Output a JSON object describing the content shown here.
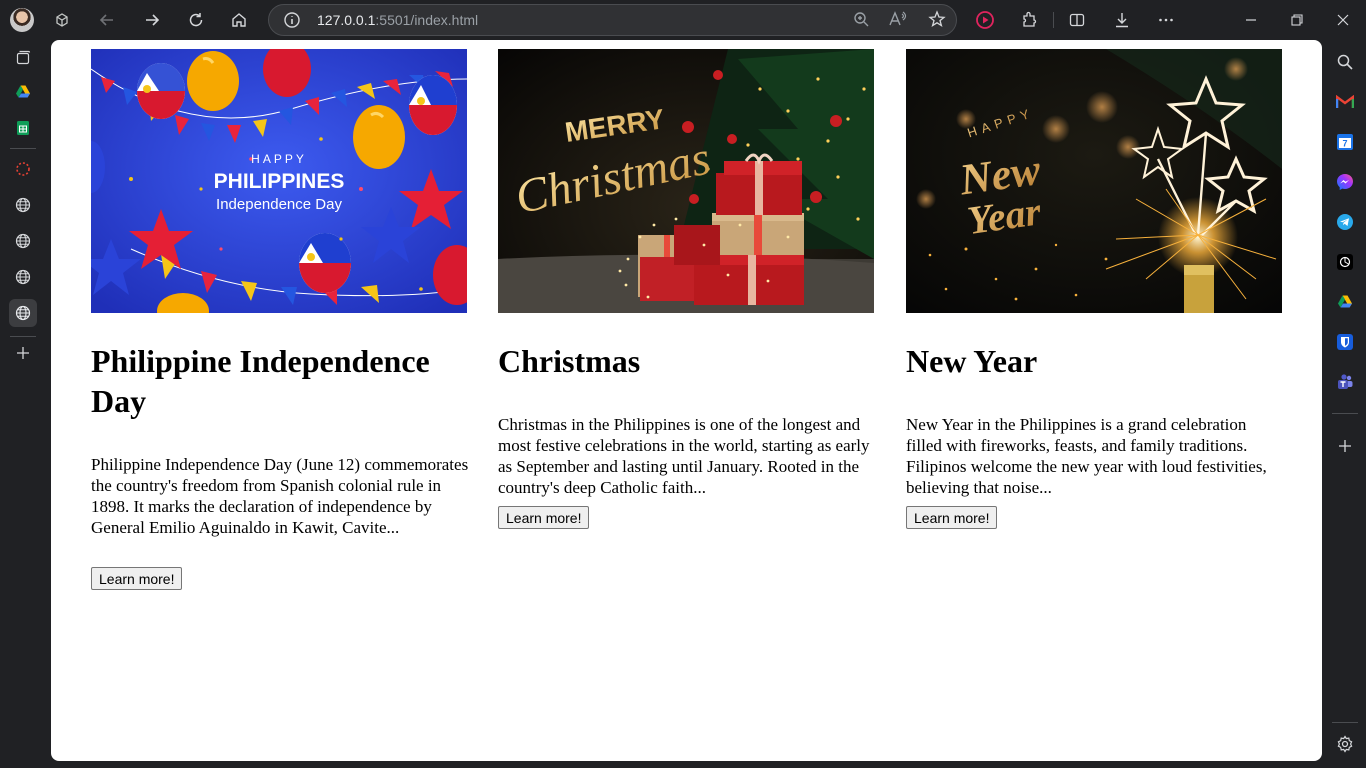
{
  "browser": {
    "url_host": "127.0.0.1",
    "url_rest": ":5501/index.html"
  },
  "cards": [
    {
      "title": "Philippine Independence Day",
      "text": "Philippine Independence Day (June 12) commemorates the country's freedom from Spanish colonial rule in 1898. It marks the declaration of independence by General Emilio Aguinaldo in Kawit, Cavite...",
      "button": "Learn more!",
      "image": {
        "line1": "HAPPY",
        "line2": "PHILIPPINES",
        "line3": "Independence Day"
      }
    },
    {
      "title": "Christmas",
      "text": "Christmas in the Philippines is one of the longest and most festive celebrations in the world, starting as early as September and lasting until January. Rooted in the country's deep Catholic faith...",
      "button": "Learn more!",
      "image": {
        "line1": "MERRY",
        "line2": "Christmas"
      }
    },
    {
      "title": "New Year",
      "text": "New Year in the Philippines is a grand celebration filled with fireworks, feasts, and family traditions. Filipinos welcome the new year with loud festivities, believing that noise...",
      "button": "Learn more!",
      "image": {
        "line1": "HAPPY",
        "line2": "New",
        "line3": "Year"
      }
    }
  ]
}
